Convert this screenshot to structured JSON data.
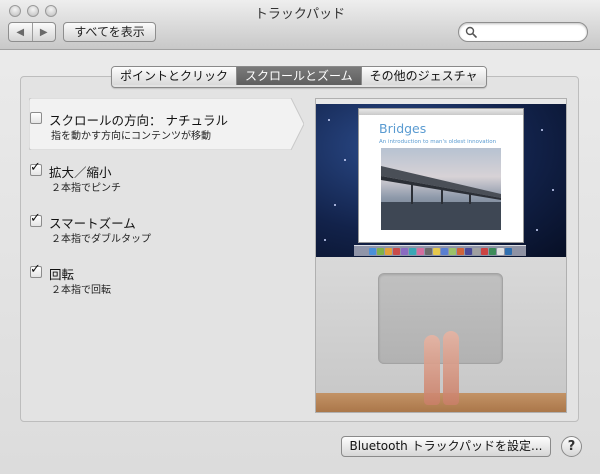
{
  "window": {
    "title": "トラックパッド",
    "show_all": "すべてを表示"
  },
  "toolbar": {
    "back_glyph": "◀",
    "forward_glyph": "▶",
    "search_placeholder": ""
  },
  "tabs": [
    {
      "label": "ポイントとクリック",
      "selected": false
    },
    {
      "label": "スクロールとズーム",
      "selected": true
    },
    {
      "label": "その他のジェスチャ",
      "selected": false
    }
  ],
  "options": [
    {
      "label": "スクロールの方向： ナチュラル",
      "sub": "指を動かす方向にコンテンツが移動",
      "checked": false,
      "selected": true
    },
    {
      "label": "拡大／縮小",
      "sub": "２本指でピンチ",
      "checked": true,
      "selected": false
    },
    {
      "label": "スマートズーム",
      "sub": "２本指でダブルタップ",
      "checked": true,
      "selected": false
    },
    {
      "label": "回転",
      "sub": "２本指で回転",
      "checked": true,
      "selected": false
    }
  ],
  "preview": {
    "doc_title": "Bridges",
    "doc_subtitle": "An introduction to man's oldest innovation",
    "doc_footer": "",
    "dock_colors": [
      "#4a90d9",
      "#7fb24a",
      "#e2a03a",
      "#c94b4b",
      "#8a6bc1",
      "#3aa7b5",
      "#d46ea0",
      "#6c6c6c",
      "#e6c84c",
      "#5a7fd1",
      "#9bc26a",
      "#d0643a",
      "#4b4b9a",
      "#a0a0a0",
      "#cc4444",
      "#3d8c5a",
      "#e0e0e0",
      "#2f6fb0"
    ]
  },
  "footer": {
    "bt_button": "Bluetooth トラックパッドを設定...",
    "help": "?"
  }
}
